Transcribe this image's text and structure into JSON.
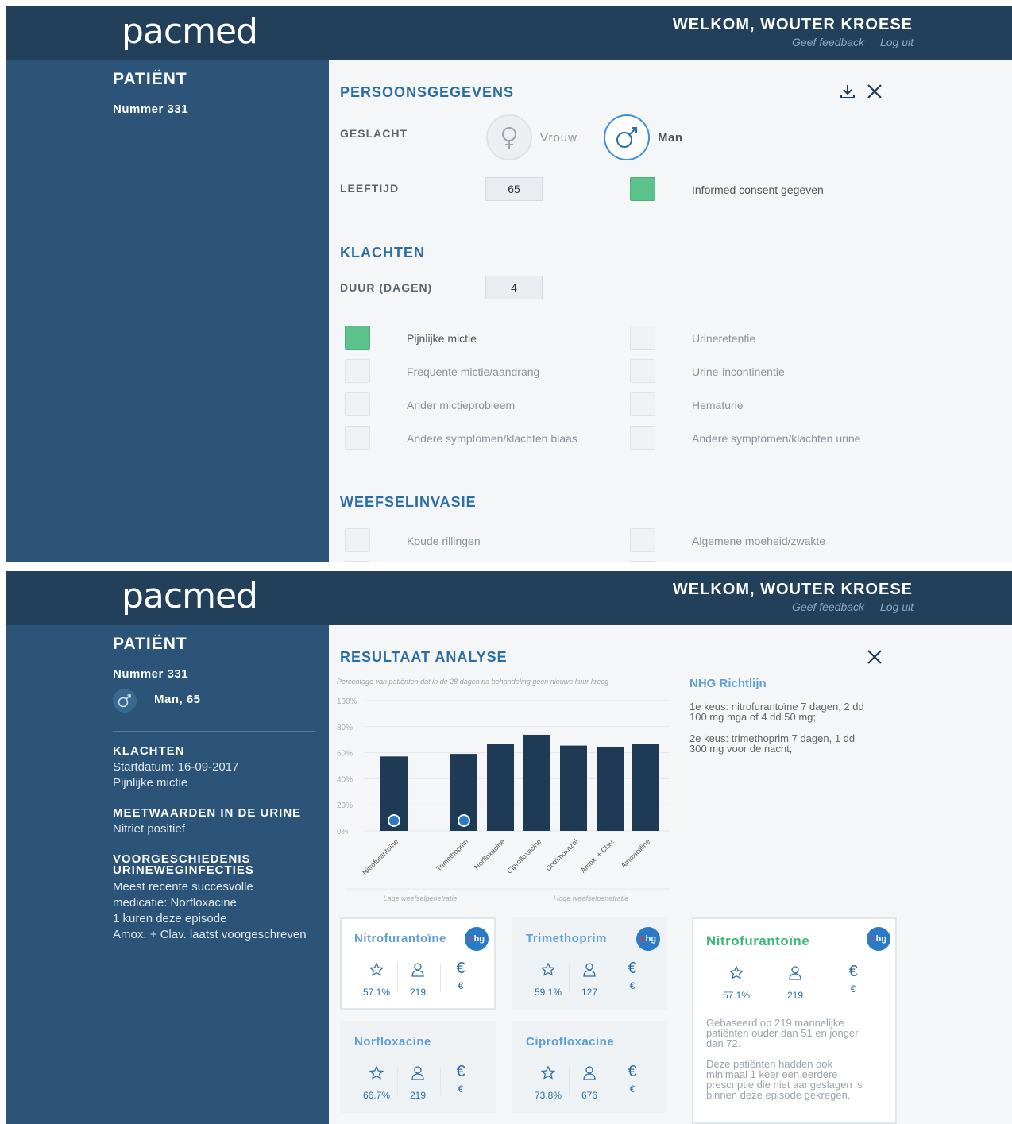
{
  "header": {
    "logo": "pacmed",
    "welcome": "WELKOM, WOUTER KROESE",
    "feedback": "Geef feedback",
    "logout": "Log uit"
  },
  "screen1": {
    "sidebar": {
      "title": "PATIËNT",
      "number": "Nummer 331"
    },
    "persoonsgegevens": {
      "title": "PERSOONSGEGEVENS",
      "geslacht_label": "GESLACHT",
      "vrouw": "Vrouw",
      "man": "Man",
      "selected_gender": "Man",
      "leeftijd_label": "LEEFTIJD",
      "leeftijd": "65",
      "consent": "Informed consent gegeven",
      "consent_checked": true
    },
    "klachten": {
      "title": "KLACHTEN",
      "duur_label": "DUUR (DAGEN)",
      "duur": "4",
      "items": [
        {
          "label": "Pijnlijke mictie",
          "checked": true
        },
        {
          "label": "Urineretentie",
          "checked": false
        },
        {
          "label": "Frequente mictie/aandrang",
          "checked": false
        },
        {
          "label": "Urine-incontinentie",
          "checked": false
        },
        {
          "label": "Ander mictieprobleem",
          "checked": false
        },
        {
          "label": "Hematurie",
          "checked": false
        },
        {
          "label": "Andere symptomen/klachten blaas",
          "checked": false
        },
        {
          "label": "Andere symptomen/klachten urine",
          "checked": false
        }
      ]
    },
    "weefselinvasie": {
      "title": "WEEFSELINVASIE",
      "items": [
        {
          "label": "Koude rillingen",
          "checked": false
        },
        {
          "label": "Algemene moeheid/zwakte",
          "checked": false
        }
      ]
    }
  },
  "screen2": {
    "sidebar": {
      "title": "PATIËNT",
      "number": "Nummer 331",
      "gender_age": "Man, 65",
      "klachten_head": "KLACHTEN",
      "startdatum": "Startdatum: 16-09-2017",
      "klacht": "Pijnlijke mictie",
      "meet_head": "MEETWAARDEN IN DE URINE",
      "nitriet": "Nitriet positief",
      "voor_head1": "VOORGESCHIEDENIS",
      "voor_head2": "URINEWEGINFECTIES",
      "voor_l1": "Meest recente succesvolle",
      "voor_l2": "medicatie: Norfloxacine",
      "voor_l3": "1 kuren deze episode",
      "voor_l4": "Amox. + Clav. laatst voorgeschreven"
    },
    "resultaat_title": "RESULTAAT ANALYSE",
    "nhg": {
      "title": "NHG Richtlijn",
      "k1a": "1e keus: nitrofurantoïne 7 dagen, 2 dd",
      "k1b": "100 mg mga of 4 dd 50 mg;",
      "k2a": "2e keus: trimethoprim 7 dagen, 1 dd",
      "k2b": "300 mg voor de nacht;"
    },
    "cards": [
      {
        "name": "Nitrofurantoïne",
        "pct": "57.1%",
        "n": "219",
        "cost": "€",
        "nhg": true
      },
      {
        "name": "Trimethoprim",
        "pct": "59.1%",
        "n": "127",
        "cost": "€",
        "nhg": true
      },
      {
        "name": "Norfloxacine",
        "pct": "66.7%",
        "n": "219",
        "cost": "€",
        "nhg": false
      },
      {
        "name": "Ciprofloxacine",
        "pct": "73.8%",
        "n": "676",
        "cost": "€",
        "nhg": false
      }
    ],
    "detail": {
      "name": "Nitrofurantoïne",
      "pct": "57.1%",
      "n": "219",
      "cost": "€",
      "d1a": "Gebaseerd op 219 mannelijke",
      "d1b": "patiënten ouder dan 51 en jonger",
      "d1c": "dan 72.",
      "d2a": "Deze patiënten hadden ook",
      "d2b": "minimaal 1 keer een eerdere",
      "d2c": "prescriptie die niet aangeslagen is",
      "d2d": "binnen deze episode gekregen."
    },
    "nhg_badge": {
      "n": "n",
      "hg": "hg"
    },
    "icons": {
      "star": "star-icon",
      "person": "person-icon",
      "euro": "euro-icon",
      "download": "download-icon",
      "close": "close-icon"
    }
  },
  "chart_data": {
    "type": "bar",
    "title": "Percentage van patiënten dat in de 28 dagen na behandeling geen nieuwe kuur kreeg",
    "categories": [
      "Nitrofurantoïne",
      "Trimethoprim",
      "Norfloxacine",
      "Ciprofloxacine",
      "Cotrimoxazol",
      "Amox. + Clav.",
      "Amoxicilline"
    ],
    "values": [
      57.1,
      59.1,
      66.7,
      73.8,
      65.5,
      64.5,
      67
    ],
    "ylim": [
      0,
      100
    ],
    "yticks": [
      "0%",
      "20%",
      "40%",
      "60%",
      "80%",
      "100%"
    ],
    "nhg_marked": [
      "Nitrofurantoïne",
      "Trimethoprim"
    ],
    "group_labels": [
      "Lage weefselpenetratie",
      "Hoge weefselpenetratie"
    ],
    "colors": {
      "bar": "#1e3a55"
    }
  }
}
